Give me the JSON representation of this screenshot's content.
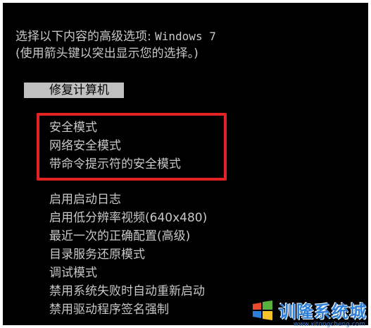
{
  "header": {
    "line1_prefix": "选择以下内容的高级选项:",
    "line1_os": "Windows 7",
    "line2": "(使用箭头键以突出显示您的选择。)"
  },
  "selected_item": "修复计算机",
  "safe_modes": [
    "安全模式",
    "网络安全模式",
    "带命令提示符的安全模式"
  ],
  "other_options": [
    "启用启动日志",
    "启用低分辨率视频(640x480)",
    "最近一次的正确配置(高级)",
    "目录服务还原模式",
    "调试模式",
    "禁用系统失败时自动重新启动",
    "禁用驱动程序签名强制"
  ],
  "watermark": {
    "text": "训隆系统城",
    "url": "www.xitongcheng.com"
  },
  "colors": {
    "background": "#000000",
    "text": "#c8c8c8",
    "selection": "#c0c0c0",
    "highlight_border": "#e32322",
    "watermark": "#2e7fd8"
  }
}
